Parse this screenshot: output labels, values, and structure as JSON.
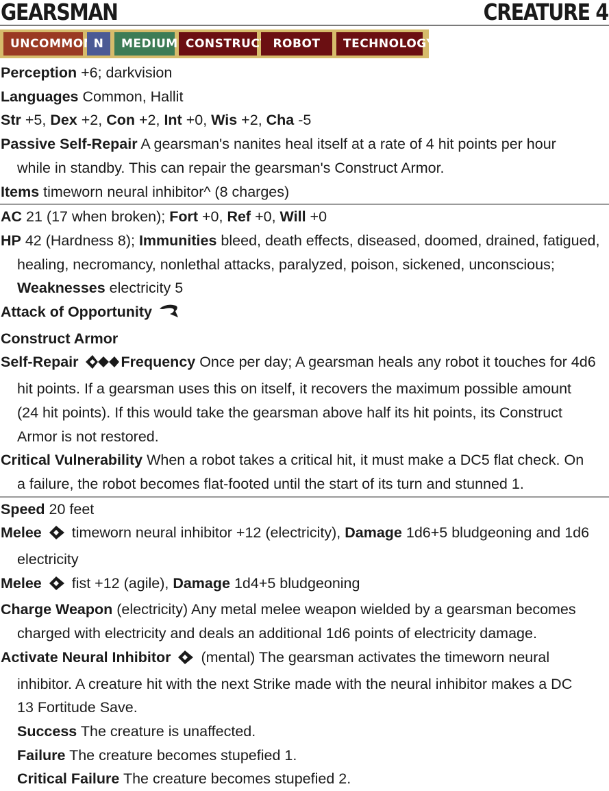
{
  "header": {
    "name": "GEARSMAN",
    "level": "CREATURE 4"
  },
  "traits": [
    "UNCOMMON",
    "N",
    "MEDIUM",
    "CONSTRUCT",
    "ROBOT",
    "TECHNOLOGY"
  ],
  "stats": {
    "perception_label": "Perception",
    "perception": " +6; darkvision",
    "languages_label": "Languages",
    "languages": " Common, Hallit",
    "str_label": "Str",
    "str": " +5, ",
    "dex_label": "Dex",
    "dex": " +2, ",
    "con_label": "Con",
    "con": " +2, ",
    "int_label": "Int",
    "int": " +0, ",
    "wis_label": "Wis",
    "wis": " +2, ",
    "cha_label": "Cha",
    "cha": " -5",
    "psr_label": "Passive Self-Repair",
    "psr_1": " A gearsman's nanites heal itself at a rate of 4 hit points per hour",
    "psr_2": "while in standby. This can repair the gearsman's Construct Armor.",
    "items_label": "Items",
    "items": " timeworn neural inhibitor^ (8 charges)"
  },
  "defense": {
    "ac_label": "AC",
    "ac": " 21 (17 when broken); ",
    "fort_label": "Fort",
    "fort": " +0, ",
    "ref_label": "Ref",
    "ref": " +0, ",
    "will_label": "Will",
    "will": " +0",
    "hp_label": "HP",
    "hp": " 42 (Hardness 8); ",
    "imm_label": "Immunities",
    "imm_1": " bleed, death effects, diseased, doomed, drained, fatigued,",
    "imm_2": "healing, necromancy, nonlethal attacks, paralyzed, poison, sickened, unconscious;",
    "weak_label": "Weaknesses",
    "weak": " electricity 5",
    "aoo": "Attack of Opportunity",
    "ca": "Construct Armor",
    "sr_label": "Self-Repair",
    "sr_freq_label": "Frequency",
    "sr_1": " Once per day; A gearsman heals any robot it touches for 4d6",
    "sr_2": "hit points. If a gearsman uses this on itself, it recovers the maximum possible amount",
    "sr_3": "(24 hit points). If this would take the gearsman above half its hit points, its Construct",
    "sr_4": "Armor is not restored.",
    "cv_label": "Critical Vulnerability",
    "cv_1": " When a robot takes a critical hit, it must make a DC5 flat check. On",
    "cv_2": "a failure, the robot becomes flat-footed until the start of its turn and stunned 1."
  },
  "offense": {
    "speed_label": "Speed",
    "speed": " 20 feet",
    "melee_label": "Melee",
    "m1_1": " timeworn neural inhibitor +12 (electricity), ",
    "damage_label": "Damage",
    "m1_dmg": " 1d6+5 bludgeoning and 1d6",
    "m1_2": "electricity",
    "m2_1": " fist +12 (agile), ",
    "m2_dmg": " 1d4+5 bludgeoning",
    "cw_label": "Charge Weapon",
    "cw_1": " (electricity) Any metal melee weapon wielded by a gearsman becomes",
    "cw_2": "charged with electricity and deals an additional 1d6 points of electricity damage.",
    "ani_label": "Activate Neural Inhibitor",
    "ani_1": " (mental) The gearsman activates the timeworn neural",
    "ani_2": "inhibitor. A creature hit with the next Strike made with the neural inhibitor makes a DC",
    "ani_3": "13 Fortitude Save.",
    "success_label": "Success",
    "success": " The creature is unaffected.",
    "failure_label": "Failure",
    "failure": " The creature becomes stupefied 1.",
    "cfail_label": "Critical Failure",
    "cfail": " The creature becomes stupefied 2."
  },
  "icons": {
    "one_action": "one-action-icon",
    "three_actions": "three-actions-icon",
    "reaction": "reaction-icon"
  }
}
